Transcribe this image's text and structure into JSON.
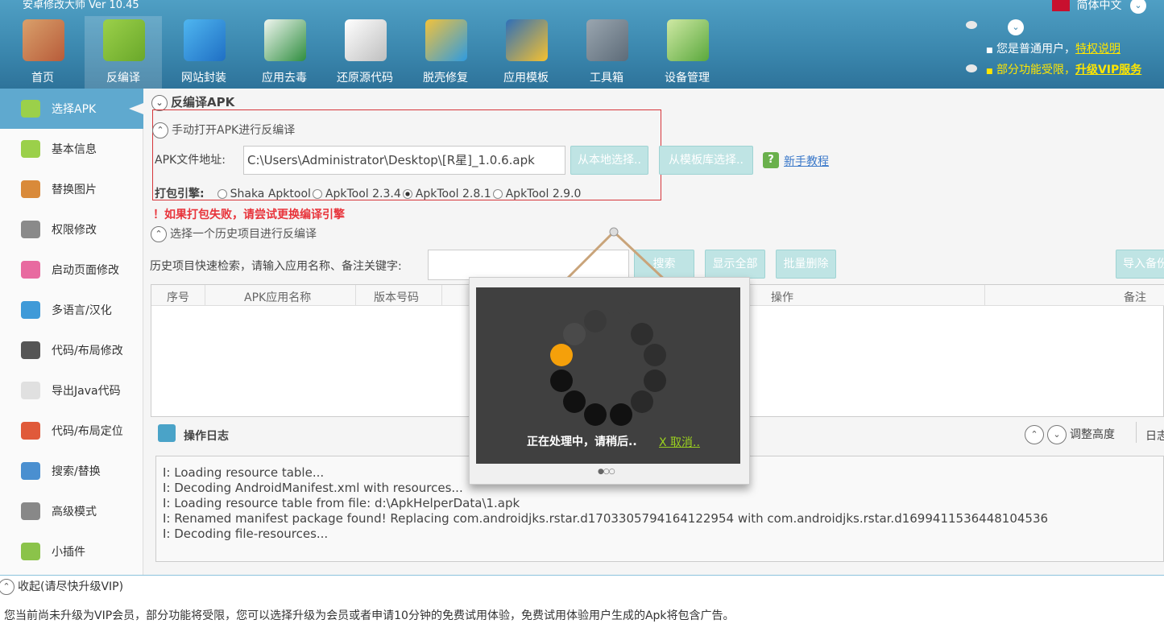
{
  "app": {
    "title": "安卓修改大师 Ver 10.45",
    "language": "简体中文"
  },
  "toolbar": [
    {
      "label": "首页",
      "icon": "home-icon"
    },
    {
      "label": "反编译",
      "icon": "android-bag-icon"
    },
    {
      "label": "网站封装",
      "icon": "ie-icon"
    },
    {
      "label": "应用去毒",
      "icon": "shield-icon"
    },
    {
      "label": "还原源代码",
      "icon": "document-icon"
    },
    {
      "label": "脱壳修复",
      "icon": "pie-icon"
    },
    {
      "label": "应用模板",
      "icon": "star-icon"
    },
    {
      "label": "工具箱",
      "icon": "safe-icon"
    },
    {
      "label": "设备管理",
      "icon": "radar-icon"
    }
  ],
  "user": {
    "line1_prefix": "您是普通用户，",
    "line1_link": "特权说明",
    "line2_prefix": "部分功能受限，",
    "line2_link": "升级VIP服务"
  },
  "sidebar": [
    {
      "label": "选择APK",
      "icon": "android-icon"
    },
    {
      "label": "基本信息",
      "icon": "android-info-icon"
    },
    {
      "label": "替换图片",
      "icon": "picture-icon"
    },
    {
      "label": "权限修改",
      "icon": "permission-icon"
    },
    {
      "label": "启动页面修改",
      "icon": "grid-icon"
    },
    {
      "label": "多语言/汉化",
      "icon": "globe-icon"
    },
    {
      "label": "代码/布局修改",
      "icon": "terminal-icon"
    },
    {
      "label": "导出Java代码",
      "icon": "file-icon"
    },
    {
      "label": "代码/布局定位",
      "icon": "map-pin-icon"
    },
    {
      "label": "搜索/替换",
      "icon": "magnifier-icon"
    },
    {
      "label": "高级模式",
      "icon": "tools-icon"
    },
    {
      "label": "小插件",
      "icon": "plugin-icon"
    }
  ],
  "decompile": {
    "section_title": "反编译APK",
    "manual_title": "手动打开APK进行反编译",
    "apk_label": "APK文件地址:",
    "apk_path": "C:\\Users\\Administrator\\Desktop\\[R星]_1.0.6.apk",
    "btn_local": "从本地选择..",
    "btn_template": "从模板库选择..",
    "tutorial": "新手教程",
    "engine_label": "打包引擎:",
    "engines": [
      "Shaka Apktool",
      "ApkTool 2.3.4",
      "ApkTool 2.8.1",
      "ApkTool 2.9.0"
    ],
    "selected_engine": "ApkTool 2.8.1",
    "warning": "！如果打包失败，请尝试更换编译引擎"
  },
  "history": {
    "title": "选择一个历史项目进行反编译",
    "search_label": "历史项目快速检索，请输入应用名称、备注关键字:",
    "search_value": "",
    "btn_search": "搜索",
    "btn_show_all": "显示全部",
    "btn_batch_delete": "批量删除",
    "btn_import": "导入备份",
    "columns": [
      "序号",
      "APK应用名称",
      "版本号码",
      "操作",
      "备注"
    ]
  },
  "log": {
    "title": "操作日志",
    "adjust_height": "调整高度",
    "right_tab": "日志",
    "lines": [
      "I: Loading resource table...",
      "I: Decoding AndroidManifest.xml with resources...",
      "I: Loading resource table from file: d:\\ApkHelperData\\1.apk",
      "I: Renamed manifest package found! Replacing com.androidjks.rstar.d1703305794164122954 with com.androidjks.rstar.d1699411536448104536",
      "I: Decoding file-resources..."
    ]
  },
  "overlay": {
    "message": "正在处理中，请稍后..",
    "cancel": "X 取消..",
    "accent": "#f5a00a"
  },
  "bottom": {
    "collapse": "收起(请尽快升级VIP)",
    "notice": "您当前尚未升级为VIP会员，部分功能将受限，您可以选择升级为会员或者申请10分钟的免费试用体验，免费试用体验用户生成的Apk将包含广告。"
  }
}
